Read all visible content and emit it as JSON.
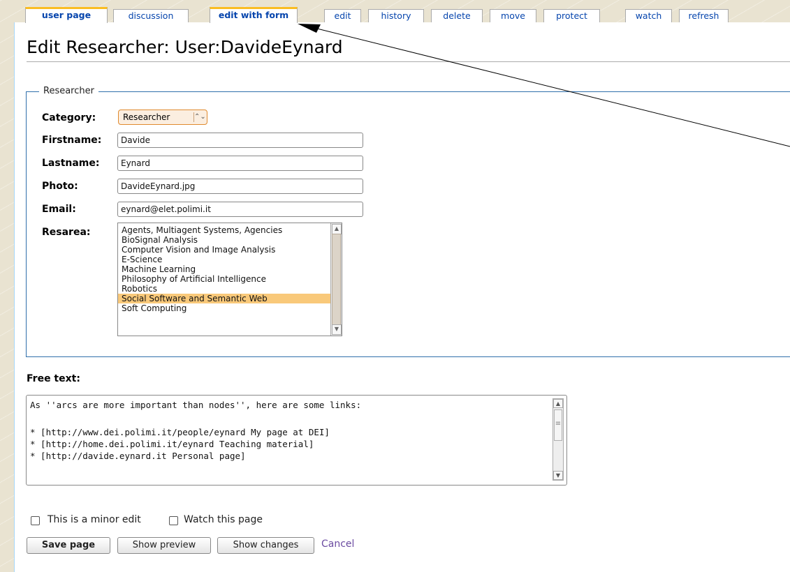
{
  "tabs": [
    {
      "label": "user page"
    },
    {
      "label": "discussion"
    },
    {
      "label": "edit with form"
    },
    {
      "label": "edit"
    },
    {
      "label": "history"
    },
    {
      "label": "delete"
    },
    {
      "label": "move"
    },
    {
      "label": "protect"
    },
    {
      "label": "watch"
    },
    {
      "label": "refresh"
    }
  ],
  "page_title": "Edit Researcher: User:DavideEynard",
  "form": {
    "legend": "Researcher",
    "category": {
      "label": "Category:",
      "value": "Researcher"
    },
    "firstname": {
      "label": "Firstname:",
      "value": "Davide"
    },
    "lastname": {
      "label": "Lastname:",
      "value": "Eynard"
    },
    "photo": {
      "label": "Photo:",
      "value": "DavideEynard.jpg"
    },
    "email": {
      "label": "Email:",
      "value": "eynard@elet.polimi.it"
    },
    "resarea": {
      "label": "Resarea:",
      "options": [
        "Agents, Multiagent Systems, Agencies",
        "BioSignal Analysis",
        "Computer Vision and Image Analysis",
        "E-Science",
        "Machine Learning",
        "Philosophy of Artificial Intelligence",
        "Robotics",
        "Social Software and Semantic Web",
        "Soft Computing"
      ],
      "selected": "Social Software and Semantic Web"
    }
  },
  "free_text": {
    "label": "Free text:",
    "lines": [
      "As ''arcs are more important than nodes'', here are some links:",
      "",
      "* [http://www.dei.polimi.it/people/eynard My page at DEI]",
      "* [http://home.dei.polimi.it/eynard Teaching material]",
      "* [http://davide.eynard.it Personal page]"
    ]
  },
  "options": {
    "minor_edit": "This is a minor edit",
    "watch_page": "Watch this page"
  },
  "buttons": {
    "save": "Save page",
    "preview": "Show preview",
    "changes": "Show changes",
    "cancel": "Cancel"
  },
  "colors": {
    "tab_selected_border": "#fabd23",
    "link": "#0645ad",
    "fieldset_border": "#2f6fab",
    "selected_option": "#f9c97a",
    "cancel_link": "#6b4ba1"
  }
}
